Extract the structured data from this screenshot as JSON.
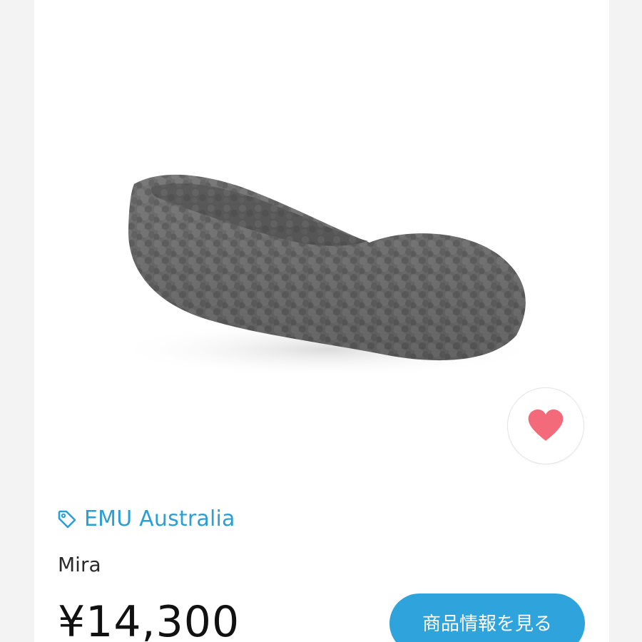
{
  "product": {
    "brand": "EMU Australia",
    "name": "Mira",
    "price": "¥14,300",
    "image_alt": "gray fleece ballet slipper"
  },
  "actions": {
    "favorite_icon": "heart-icon",
    "brand_icon": "tag-icon",
    "view_details_label": "商品情報を見る"
  },
  "colors": {
    "accent_blue": "#2ea3dc",
    "heart_pink": "#f36b7a",
    "price_text": "#111111"
  }
}
